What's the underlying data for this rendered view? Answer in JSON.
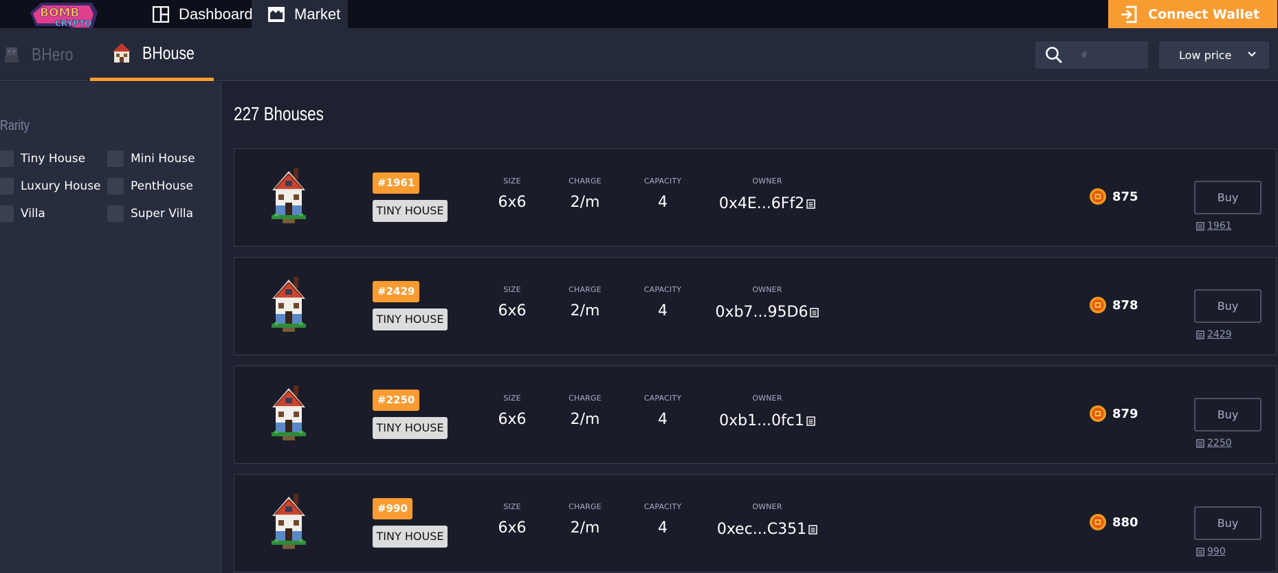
{
  "topnav": {
    "tabs": [
      {
        "label": "Dashboard",
        "icon": "dashboard-grid-icon"
      },
      {
        "label": "Market",
        "icon": "market-icon"
      }
    ],
    "connect_label": "Connect Wallet",
    "accent": "#f89c32"
  },
  "subnav": {
    "tabs": [
      {
        "label": "BHero",
        "icon": "hero-icon"
      },
      {
        "label": "BHouse",
        "icon": "house-icon"
      }
    ],
    "search_placeholder": "#",
    "sort_value": "Low price"
  },
  "sidebar": {
    "title": "Rarity",
    "options": [
      "Tiny House",
      "Mini House",
      "Luxury House",
      "PentHouse",
      "Villa",
      "Super Villa"
    ]
  },
  "main": {
    "count_title": "227 Bhouses",
    "labels": {
      "size": "SIZE",
      "charge": "CHARGE",
      "capacity": "CAPACITY",
      "owner": "OWNER",
      "buy": "Buy"
    },
    "listings": [
      {
        "id": "#1961",
        "type": "TINY HOUSE",
        "size": "6x6",
        "charge": "2/m",
        "capacity": "4",
        "owner": "0x4E...6Ff2",
        "price": "875",
        "token": "1961"
      },
      {
        "id": "#2429",
        "type": "TINY HOUSE",
        "size": "6x6",
        "charge": "2/m",
        "capacity": "4",
        "owner": "0xb7...95D6",
        "price": "878",
        "token": "2429"
      },
      {
        "id": "#2250",
        "type": "TINY HOUSE",
        "size": "6x6",
        "charge": "2/m",
        "capacity": "4",
        "owner": "0xb1...0fc1",
        "price": "879",
        "token": "2250"
      },
      {
        "id": "#990",
        "type": "TINY HOUSE",
        "size": "6x6",
        "charge": "2/m",
        "capacity": "4",
        "owner": "0xec...C351",
        "price": "880",
        "token": "990"
      }
    ]
  }
}
